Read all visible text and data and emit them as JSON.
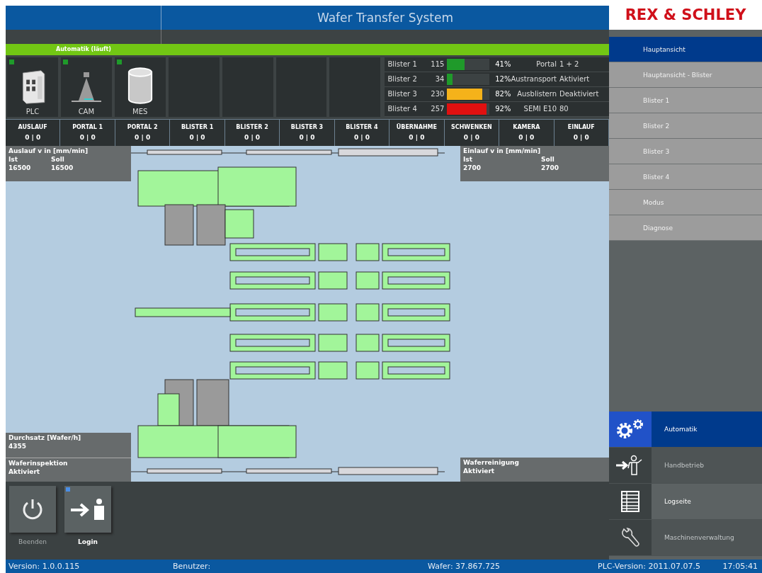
{
  "header": {
    "title": "Wafer Transfer System",
    "logo": "REX & SCHLEY"
  },
  "mode_banner": "Automatik (läuft)",
  "devices": [
    {
      "kind": "plc",
      "label": "PLC",
      "indicator": true
    },
    {
      "kind": "camera",
      "label": "CAM",
      "indicator": true
    },
    {
      "kind": "database",
      "label": "MES",
      "indicator": true
    },
    {
      "kind": "empty"
    },
    {
      "kind": "empty"
    },
    {
      "kind": "empty"
    },
    {
      "kind": "empty"
    }
  ],
  "blister_status": [
    {
      "name": "Blister 1",
      "count": "115",
      "level": 0.41,
      "color": "#1f9a2a",
      "percent": "41%",
      "label": "Portal",
      "value": "1 + 2"
    },
    {
      "name": "Blister 2",
      "count": "34",
      "level": 0.12,
      "color": "#1f9a2a",
      "percent": "12%",
      "label": "Austransport",
      "value": "Aktiviert"
    },
    {
      "name": "Blister 3",
      "count": "230",
      "level": 0.82,
      "color": "#f5b21a",
      "percent": "82%",
      "label": "Ausblistern",
      "value": "Deaktiviert"
    },
    {
      "name": "Blister 4",
      "count": "257",
      "level": 0.92,
      "color": "#e01010",
      "percent": "92%",
      "label": "SEMI E10",
      "value": "80"
    }
  ],
  "stations": [
    {
      "name": "AUSLAUF",
      "value": "0 | 0"
    },
    {
      "name": "PORTAL 1",
      "value": "0 | 0"
    },
    {
      "name": "PORTAL 2",
      "value": "0 | 0"
    },
    {
      "name": "BLISTER 1",
      "value": "0 | 0"
    },
    {
      "name": "BLISTER 2",
      "value": "0 | 0"
    },
    {
      "name": "BLISTER 3",
      "value": "0 | 0"
    },
    {
      "name": "BLISTER 4",
      "value": "0 | 0"
    },
    {
      "name": "ÜBERNAHME",
      "value": "0 | 0"
    },
    {
      "name": "SCHWENKEN",
      "value": "0 | 0"
    },
    {
      "name": "KAMERA",
      "value": "0 | 0"
    },
    {
      "name": "EINLAUF",
      "value": "0 | 0"
    }
  ],
  "outfeed": {
    "title": "Auslauf v in [mm/min]",
    "actual_label": "Ist",
    "target_label": "Soll",
    "actual": "16500",
    "target": "16500"
  },
  "infeed": {
    "title": "Einlauf v in [mm/min]",
    "actual_label": "Ist",
    "target_label": "Soll",
    "actual": "2700",
    "target": "2700"
  },
  "throughput": {
    "title": "Durchsatz [Wafer/h]",
    "value": "4355"
  },
  "inspection": {
    "title": "Waferinspektion",
    "value": "Aktiviert"
  },
  "cleaning": {
    "title": "Waferreinigung",
    "value": "Aktiviert"
  },
  "actions": [
    {
      "kind": "power",
      "label": "Beenden",
      "disabled": true,
      "indicator": false
    },
    {
      "kind": "login",
      "label": "Login",
      "disabled": false,
      "indicator": true
    }
  ],
  "nav": [
    {
      "label": "Hauptansicht",
      "selected": true
    },
    {
      "label": "Hauptansicht - Blister",
      "selected": false
    },
    {
      "label": "Blister 1",
      "selected": false
    },
    {
      "label": "Blister 2",
      "selected": false
    },
    {
      "label": "Blister 3",
      "selected": false
    },
    {
      "label": "Blister 4",
      "selected": false
    },
    {
      "label": "Modus",
      "selected": false
    },
    {
      "label": "Diagnose",
      "selected": false
    }
  ],
  "modes": [
    {
      "kind": "gears",
      "label": "Automatik",
      "selected": true,
      "disabled": false
    },
    {
      "kind": "manual",
      "label": "Handbetrieb",
      "selected": false,
      "disabled": true
    },
    {
      "kind": "list",
      "label": "Logseite",
      "selected": false,
      "disabled": false
    },
    {
      "kind": "wrench",
      "label": "Maschinenverwaltung",
      "selected": false,
      "disabled": true
    }
  ],
  "status_bar": {
    "version": "Version: 1.0.0.115",
    "user": "Benutzer:",
    "wafer": "Wafer: 37.867.725",
    "plc_version": "PLC-Version: 2011.07.07.5",
    "time": "17:05:41"
  }
}
